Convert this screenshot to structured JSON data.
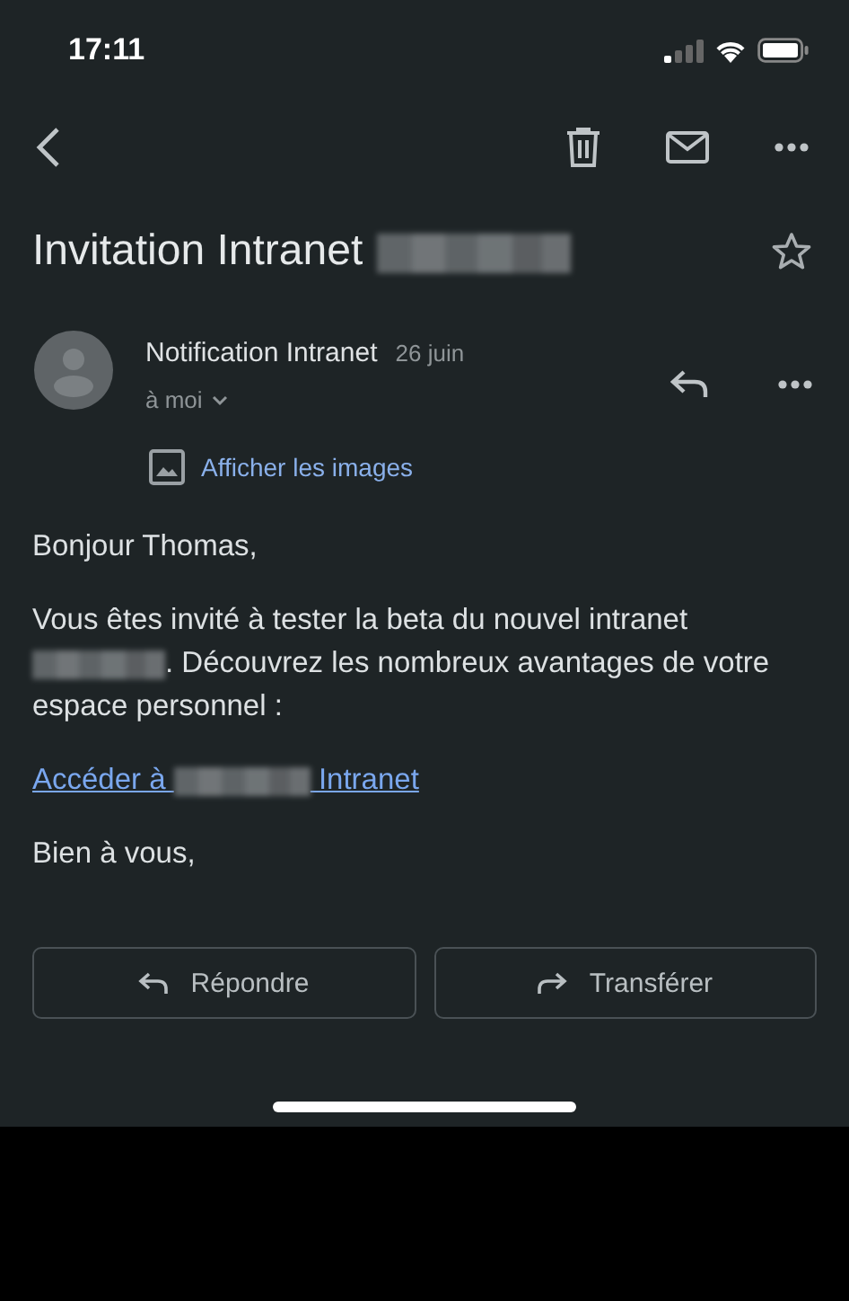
{
  "status_bar": {
    "time": "17:11"
  },
  "subject": {
    "parts": [
      {
        "kind": "text",
        "text": "Invitation Intranet"
      },
      {
        "kind": "redacted"
      }
    ],
    "starred": false
  },
  "message": {
    "sender": "Notification Intranet",
    "date": "26 juin",
    "recipient": "à moi",
    "recipient_expanded": false,
    "show_images": "Afficher les images"
  },
  "body": [
    {
      "kind": "paragraph",
      "parts": [
        {
          "kind": "text",
          "text": "Bonjour Thomas,"
        }
      ]
    },
    {
      "kind": "paragraph",
      "parts": [
        {
          "kind": "text",
          "text": "Vous êtes invité à tester la beta du nouvel intranet "
        },
        {
          "kind": "redacted"
        },
        {
          "kind": "text",
          "text": ". Découvrez les nombreux avantages de votre espace personnel :"
        }
      ]
    },
    {
      "kind": "link",
      "parts": [
        {
          "kind": "text",
          "text": "Accéder à "
        },
        {
          "kind": "redacted"
        },
        {
          "kind": "text",
          "text": " Intranet"
        }
      ]
    },
    {
      "kind": "paragraph",
      "parts": [
        {
          "kind": "text",
          "text": "Bien à vous,"
        }
      ]
    }
  ],
  "actions": [
    {
      "kind": "reply",
      "label": "Répondre"
    },
    {
      "kind": "forward",
      "label": "Transférer"
    }
  ]
}
